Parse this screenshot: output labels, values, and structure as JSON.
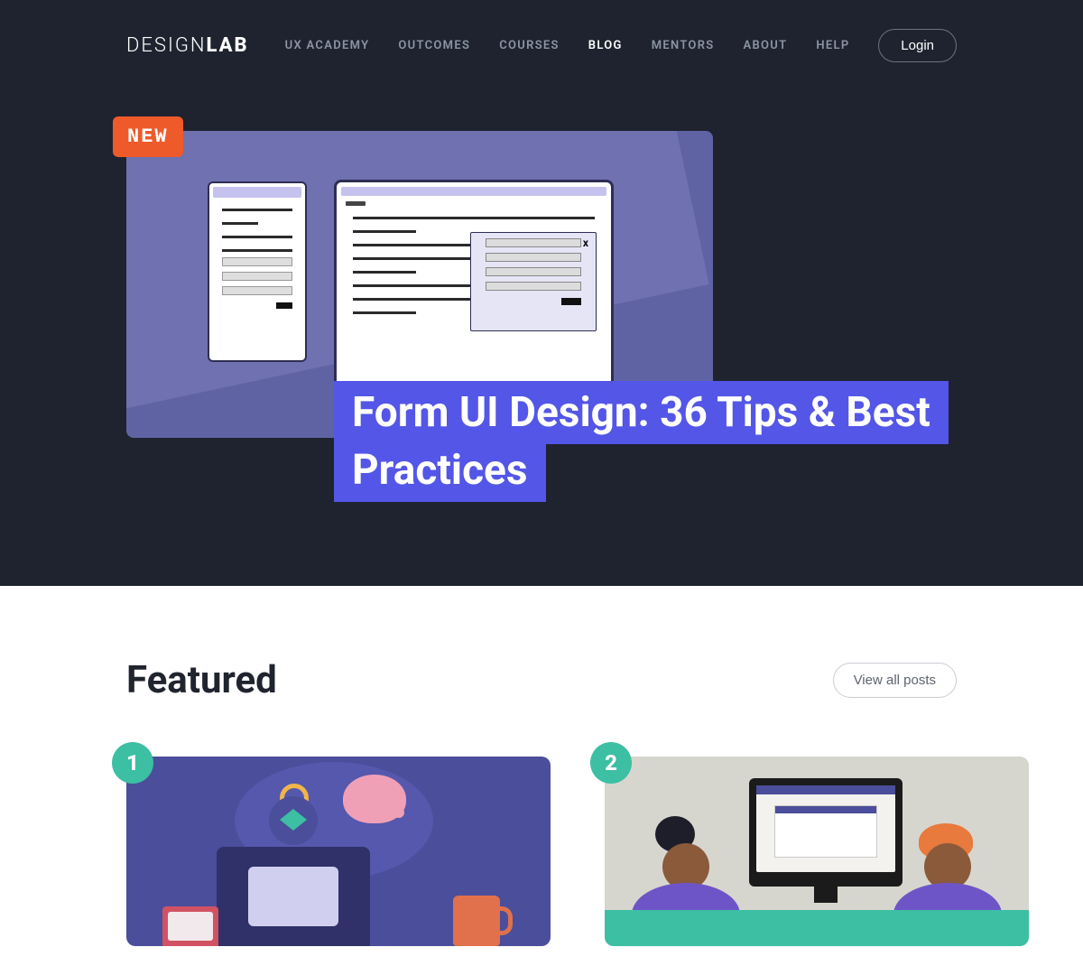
{
  "brand": {
    "light": "DESIGN",
    "bold": "LAB"
  },
  "nav": {
    "items": [
      {
        "label": "UX ACADEMY"
      },
      {
        "label": "OUTCOMES"
      },
      {
        "label": "COURSES"
      },
      {
        "label": "BLOG"
      },
      {
        "label": "MENTORS"
      },
      {
        "label": "ABOUT"
      },
      {
        "label": "HELP"
      }
    ],
    "active_index": 3,
    "login": "Login"
  },
  "hero": {
    "badge": "NEW",
    "modal_close": "x",
    "title": "Form UI Design: 36 Tips & Best Practices"
  },
  "featured": {
    "heading": "Featured",
    "view_all": "View all posts",
    "cards": [
      {
        "rank": "1"
      },
      {
        "rank": "2"
      }
    ]
  }
}
